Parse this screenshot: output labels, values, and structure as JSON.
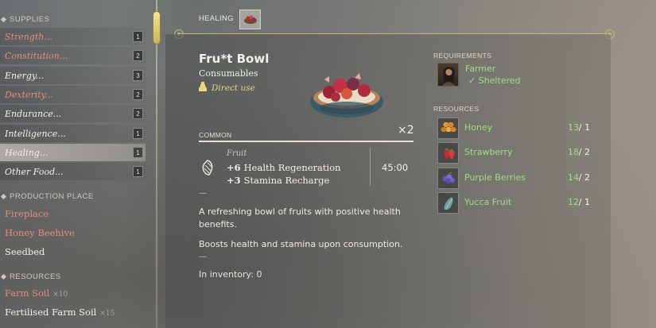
{
  "sidebar": {
    "supplies_header": "SUPPLIES",
    "supplies": [
      {
        "label": "Strength...",
        "count": "1",
        "color": "red"
      },
      {
        "label": "Constitution...",
        "count": "2",
        "color": "red"
      },
      {
        "label": "Energy...",
        "count": "3",
        "color": "white"
      },
      {
        "label": "Dexterity...",
        "count": "2",
        "color": "red"
      },
      {
        "label": "Endurance...",
        "count": "2",
        "color": "white"
      },
      {
        "label": "Intelligence...",
        "count": "1",
        "color": "white"
      },
      {
        "label": "Healing...",
        "count": "1",
        "color": "white",
        "selected": true
      },
      {
        "label": "Other Food...",
        "count": "1",
        "color": "white"
      }
    ],
    "production_header": "PRODUCTION PLACE",
    "production": [
      {
        "label": "Fireplace",
        "color": "red"
      },
      {
        "label": "Honey Beehive",
        "color": "red"
      },
      {
        "label": "Seedbed",
        "color": "white"
      }
    ],
    "resources_header": "RESOURCES",
    "resources": [
      {
        "label": "Farm Soil",
        "qty": "×10",
        "color": "red"
      },
      {
        "label": "Fertilised Farm Soil",
        "qty": "×15",
        "color": "white"
      }
    ]
  },
  "header": {
    "tab_label": "HEALING",
    "tab_icon": "fruit-bowl-icon"
  },
  "item": {
    "title": "Fru*t Bowl",
    "category": "Consumables",
    "direct_use": "Direct use",
    "rarity": "COMMON",
    "count": "×2",
    "effect_label": "Fruit",
    "effects": [
      {
        "value": "+6",
        "name": "Health Regeneration"
      },
      {
        "value": "+3",
        "name": "Stamina Recharge"
      }
    ],
    "duration": "45:00",
    "dash": "—",
    "description_1": "A refreshing bowl of fruits with positive health benefits.",
    "description_2": "Boosts health and stamina upon consumption.",
    "inventory": "In inventory: 0"
  },
  "requirements": {
    "header": "REQUIREMENTS",
    "npc": "Farmer",
    "condition": "✓ Sheltered"
  },
  "resources": {
    "header": "RESOURCES",
    "items": [
      {
        "name": "Honey",
        "have": "13",
        "need": "/ 1",
        "icon": "honeycomb-icon"
      },
      {
        "name": "Strawberry",
        "have": "18",
        "need": "/ 2",
        "icon": "strawberry-icon"
      },
      {
        "name": "Purple Berries",
        "have": "14",
        "need": "/ 2",
        "icon": "purple-berries-icon"
      },
      {
        "name": "Yucca Fruit",
        "have": "12",
        "need": "/ 1",
        "icon": "yucca-fruit-icon"
      }
    ]
  },
  "colors": {
    "accent_gold": "#c8b56e",
    "available_green": "#9fdc84",
    "locked_red": "#e48c7c",
    "direct_use_yellow": "#e9d67a"
  }
}
